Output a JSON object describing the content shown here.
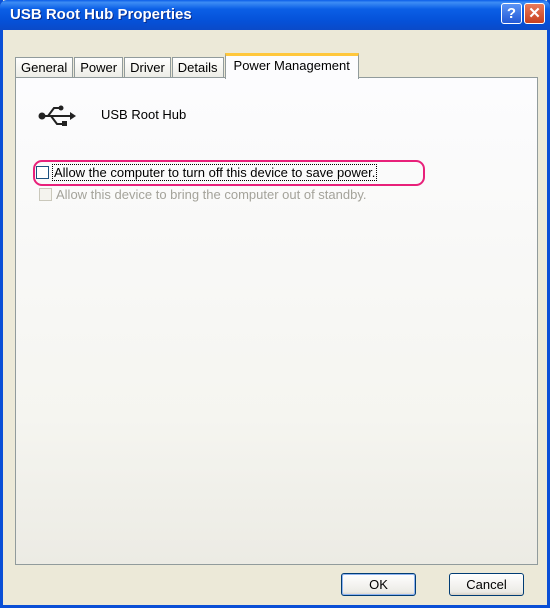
{
  "window": {
    "title": "USB Root Hub Properties",
    "help_icon": "help-icon",
    "close_icon": "close-icon"
  },
  "tabs": [
    {
      "label": "General",
      "active": false
    },
    {
      "label": "Power",
      "active": false
    },
    {
      "label": "Driver",
      "active": false
    },
    {
      "label": "Details",
      "active": false
    },
    {
      "label": "Power Management",
      "active": true
    }
  ],
  "panel": {
    "device_icon": "usb-icon",
    "device_name": "USB Root Hub",
    "options": [
      {
        "label": "Allow the computer to turn off this device to save power.",
        "checked": false,
        "enabled": true
      },
      {
        "label": "Allow this device to bring the computer out of standby.",
        "checked": false,
        "enabled": false
      }
    ]
  },
  "buttons": {
    "ok": "OK",
    "cancel": "Cancel"
  },
  "colors": {
    "titlebar": "#0a5de8",
    "highlight": "#e8207a",
    "active_tab_accent": "#ffc73c"
  }
}
